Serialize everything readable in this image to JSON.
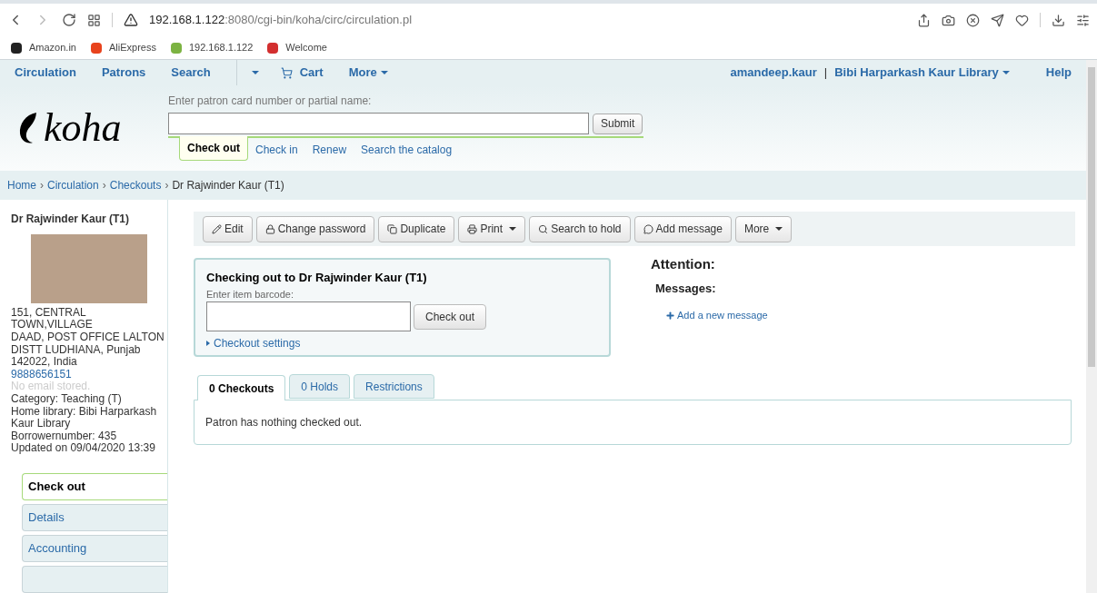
{
  "browser": {
    "address_host": "192.168.1.122",
    "address_path": ":8080/cgi-bin/koha/circ/circulation.pl",
    "bookmarks": [
      {
        "label": "Amazon.in",
        "color": "#222222"
      },
      {
        "label": "AliExpress",
        "color": "#e8431d"
      },
      {
        "label": "192.168.1.122",
        "color": "#7cb342"
      },
      {
        "label": "Welcome",
        "color": "#d32f2f"
      }
    ]
  },
  "nav": {
    "left": [
      {
        "label": "Circulation",
        "dropdown": false
      },
      {
        "label": "Patrons",
        "dropdown": false
      },
      {
        "label": "Search",
        "dropdown": false
      },
      {
        "label": "Cart",
        "dropdown": false
      },
      {
        "label": "More",
        "dropdown": true
      }
    ],
    "user": "amandeep.kaur",
    "separator": "|",
    "library": "Bibi Harparkash Kaur Library",
    "help": "Help"
  },
  "header": {
    "logo": "koha",
    "search_label": "Enter patron card number or partial name:",
    "submit": "Submit",
    "tabs": [
      {
        "label": "Check out",
        "selected": true
      },
      {
        "label": "Check in",
        "selected": false
      },
      {
        "label": "Renew",
        "selected": false
      },
      {
        "label": "Search the catalog",
        "selected": false
      }
    ]
  },
  "breadcrumb_separator": "›",
  "breadcrumb": [
    {
      "label": "Home",
      "link": true
    },
    {
      "label": "Circulation",
      "link": true
    },
    {
      "label": "Checkouts",
      "link": true
    },
    {
      "label": "Dr Rajwinder Kaur (T1)",
      "link": false
    }
  ],
  "patron": {
    "name": "Dr Rajwinder Kaur (T1)",
    "address_lines": [
      "151, CENTRAL",
      "TOWN,VILLAGE",
      "DAAD, POST OFFICE LALTON",
      "DISTT LUDHIANA, Punjab",
      "142022, India"
    ],
    "phone": "9888656151",
    "email_note": "No email stored.",
    "details": [
      "Category: Teaching (T)",
      "Home library: Bibi Harparkash Kaur Library",
      "Borrowernumber: 435",
      "Updated on 09/04/2020 13:39"
    ]
  },
  "side_menu": [
    {
      "label": "Check out",
      "selected": true
    },
    {
      "label": "Details",
      "selected": false
    },
    {
      "label": "Accounting",
      "selected": false
    },
    {
      "selected": false
    }
  ],
  "toolbar": [
    {
      "label": "Edit",
      "dropdown": false
    },
    {
      "label": "Change password",
      "dropdown": false
    },
    {
      "label": "Duplicate",
      "dropdown": false
    },
    {
      "label": "Print",
      "dropdown": true
    },
    {
      "label": "Search to hold",
      "dropdown": false
    },
    {
      "label": "Add message",
      "dropdown": false
    },
    {
      "label": "More",
      "dropdown": true
    }
  ],
  "checkout": {
    "title": "Checking out to Dr Rajwinder Kaur (T1)",
    "barcode_label": "Enter item barcode:",
    "button": "Check out",
    "settings": "Checkout settings",
    "settings_expanded": false
  },
  "attention": {
    "title": "Attention:",
    "messages_title": "Messages:",
    "add_message": "Add a new message"
  },
  "tabs": [
    {
      "label": "0 Checkouts",
      "selected": true
    },
    {
      "label": "0 Holds",
      "selected": false
    },
    {
      "label": "Restrictions",
      "selected": false
    }
  ],
  "tab_content": "Patron has nothing checked out."
}
